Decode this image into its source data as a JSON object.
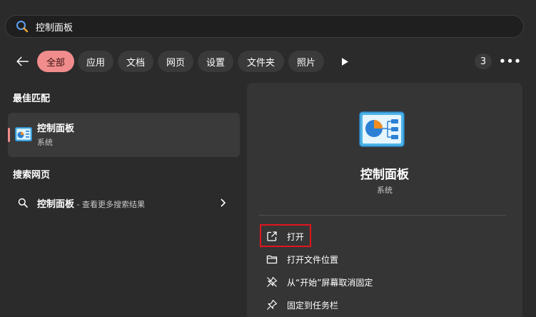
{
  "search": {
    "query": "控制面板"
  },
  "filters": {
    "chips": [
      "全部",
      "应用",
      "文档",
      "网页",
      "设置",
      "文件夹",
      "照片"
    ],
    "count": "3",
    "more": "•••"
  },
  "best_match": {
    "title": "最佳匹配",
    "name": "控制面板",
    "type": "系统"
  },
  "web": {
    "title": "搜索网页",
    "query": "控制面板",
    "suffix": " - 查看更多搜索结果"
  },
  "detail": {
    "name": "控制面板",
    "type": "系统",
    "actions": [
      {
        "label": "打开",
        "icon": "open-external-icon"
      },
      {
        "label": "打开文件位置",
        "icon": "folder-icon"
      },
      {
        "label": "从“开始”屏幕取消固定",
        "icon": "unpin-icon"
      },
      {
        "label": "固定到任务栏",
        "icon": "pin-icon"
      }
    ]
  },
  "colors": {
    "accent": "#f08c8c",
    "highlight": "#e0161e",
    "background": "#2b2b2b"
  }
}
